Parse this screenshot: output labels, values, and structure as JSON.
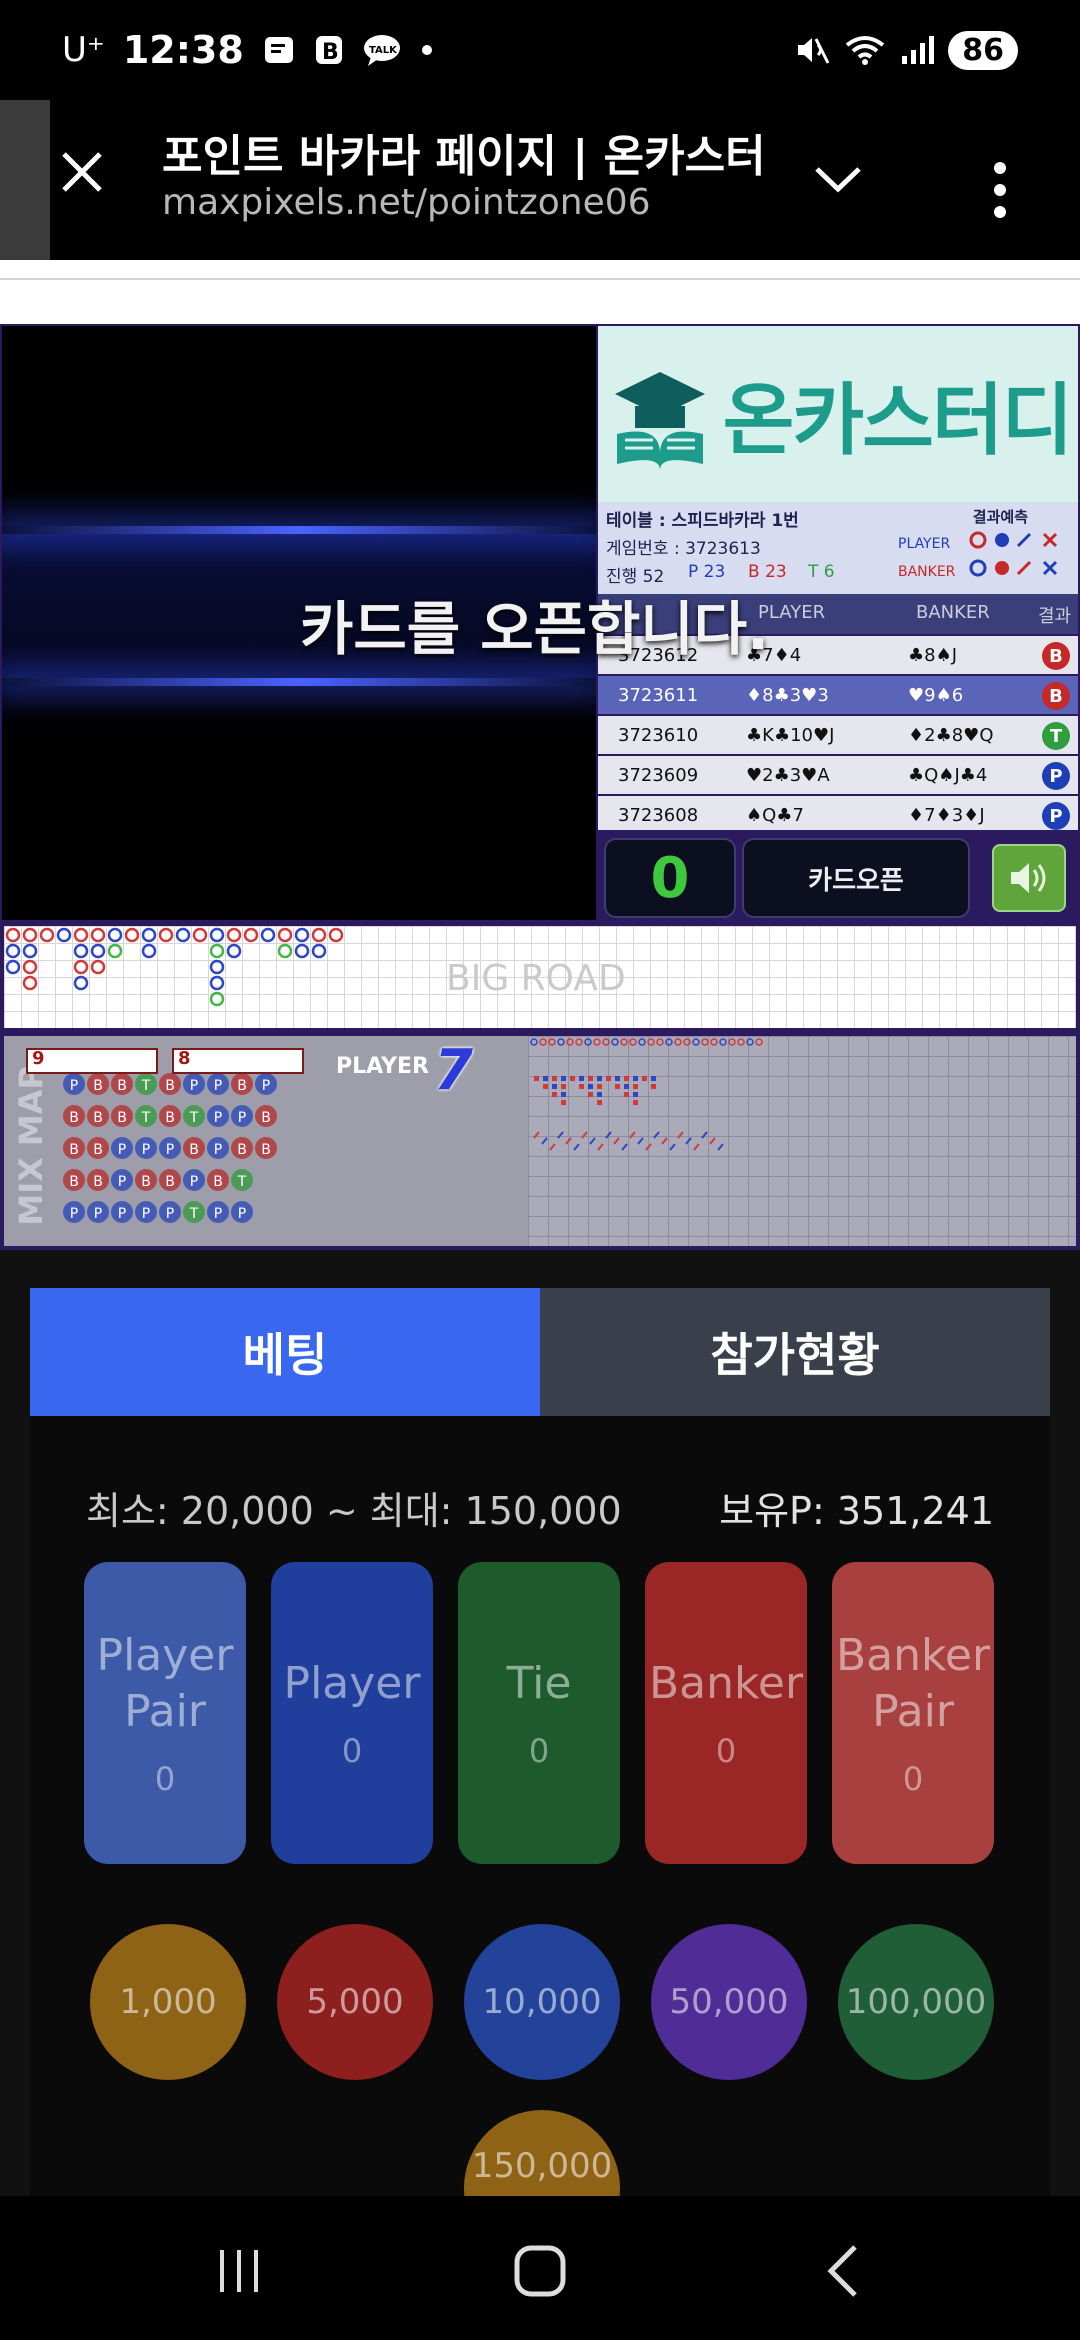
{
  "status_bar": {
    "carrier": "U⁺",
    "time": "12:38",
    "battery": "86"
  },
  "browser": {
    "page_title": "포인트 바카라 페이지 | 온카스터디",
    "url": "maxpixels.net/pointzone06"
  },
  "game": {
    "overlay_message": "카드를 오픈합니다.",
    "logo_text": "온카스터디",
    "table_info": {
      "table": "테이블 : 스피드바카라 1번",
      "game_no": "게임번호 : 3723613",
      "progress": "진행 52",
      "p_count": "P 23",
      "b_count": "B 23",
      "t_count": "T 6",
      "prediction_title": "결과예측",
      "pred_player": "PLAYER",
      "pred_banker": "BANKER"
    },
    "history_header": {
      "col_player": "PLAYER",
      "col_banker": "BANKER",
      "col_result": "결과"
    },
    "history": [
      {
        "id": "3723612",
        "player": "♣7♦4",
        "banker": "♣8♠J",
        "result": "B",
        "result_color": "#c62828"
      },
      {
        "id": "3723611",
        "player": "♦8♣3♥3",
        "banker": "♥9♠6",
        "result": "B",
        "result_color": "#c62828"
      },
      {
        "id": "3723610",
        "player": "♣K♣10♥J",
        "banker": "♦2♣8♥Q",
        "result": "T",
        "result_color": "#2e9e3e"
      },
      {
        "id": "3723609",
        "player": "♥2♣3♥A",
        "banker": "♣Q♠J♣4",
        "result": "P",
        "result_color": "#1e3fb8"
      },
      {
        "id": "3723608",
        "player": "♠Q♣7",
        "banker": "♦7♦3♦J",
        "result": "P",
        "result_color": "#1e3fb8"
      }
    ],
    "count": "0",
    "card_open_label": "카드오픈",
    "big_road_label": "BIG ROAD",
    "mix_map_label": "MIX MAP",
    "card1": "9",
    "card2": "8",
    "player_label": "PLAYER",
    "player_score": "7"
  },
  "tabs": {
    "betting": "베팅",
    "status": "참가현황"
  },
  "betting": {
    "limits": "최소: 20,000 ~ 최대: 150,000",
    "balance": "보유P: 351,241",
    "options": [
      {
        "line1": "Player",
        "line2": "Pair",
        "value": "0",
        "color": "#3d5aa8"
      },
      {
        "line1": "Player",
        "line2": "",
        "value": "0",
        "color": "#203f9c"
      },
      {
        "line1": "Tie",
        "line2": "",
        "value": "0",
        "color": "#1d5a2c"
      },
      {
        "line1": "Banker",
        "line2": "",
        "value": "0",
        "color": "#9a2626"
      },
      {
        "line1": "Banker",
        "line2": "Pair",
        "value": "0",
        "color": "#a8403f"
      }
    ],
    "chips": [
      {
        "label": "1,000",
        "color": "#8e6315"
      },
      {
        "label": "5,000",
        "color": "#8e1f1f"
      },
      {
        "label": "10,000",
        "color": "#23429a"
      },
      {
        "label": "50,000",
        "color": "#4f2c96"
      },
      {
        "label": "100,000",
        "color": "#1f5e36"
      },
      {
        "label": "150,000",
        "color": "#8e6315"
      }
    ]
  }
}
